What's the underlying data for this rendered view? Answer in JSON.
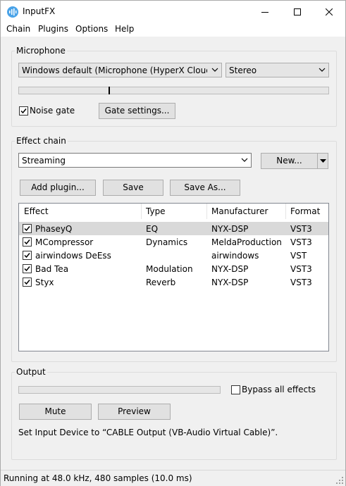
{
  "window": {
    "title": "InputFX"
  },
  "menu": [
    "Chain",
    "Plugins",
    "Options",
    "Help"
  ],
  "microphone": {
    "group_label": "Microphone",
    "device": "Windows default (Microphone (HyperX Cloud III))",
    "channels": "Stereo",
    "level": 0.29,
    "noise_gate_label": "Noise gate",
    "noise_gate_checked": true,
    "gate_settings_label": "Gate settings..."
  },
  "effect_chain": {
    "group_label": "Effect chain",
    "preset": "Streaming",
    "new_label": "New...",
    "add_plugin_label": "Add plugin...",
    "save_label": "Save",
    "save_as_label": "Save As...",
    "columns": [
      "Effect",
      "Type",
      "Manufacturer",
      "Format"
    ],
    "rows": [
      {
        "effect": "PhaseyQ",
        "type": "EQ",
        "manufacturer": "NYX-DSP",
        "format": "VST3",
        "checked": true,
        "selected": true
      },
      {
        "effect": "MCompressor",
        "type": "Dynamics",
        "manufacturer": "MeldaProduction",
        "format": "VST3",
        "checked": true,
        "selected": false
      },
      {
        "effect": "airwindows DeEss",
        "type": "",
        "manufacturer": "airwindows",
        "format": "VST",
        "checked": true,
        "selected": false
      },
      {
        "effect": "Bad Tea",
        "type": "Modulation",
        "manufacturer": "NYX-DSP",
        "format": "VST3",
        "checked": true,
        "selected": false
      },
      {
        "effect": "Styx",
        "type": "Reverb",
        "manufacturer": "NYX-DSP",
        "format": "VST3",
        "checked": true,
        "selected": false
      }
    ]
  },
  "output": {
    "group_label": "Output",
    "level": 0,
    "bypass_label": "Bypass all effects",
    "bypass_checked": false,
    "mute_label": "Mute",
    "preview_label": "Preview",
    "hint": "Set Input Device to “CABLE Output (VB-Audio Virtual Cable)”."
  },
  "status": "Running at 48.0 kHz, 480 samples (10.0 ms)",
  "icons": {
    "app": "microphone-app-icon",
    "minimize": "minimize-icon",
    "maximize": "maximize-icon",
    "close": "close-icon"
  }
}
